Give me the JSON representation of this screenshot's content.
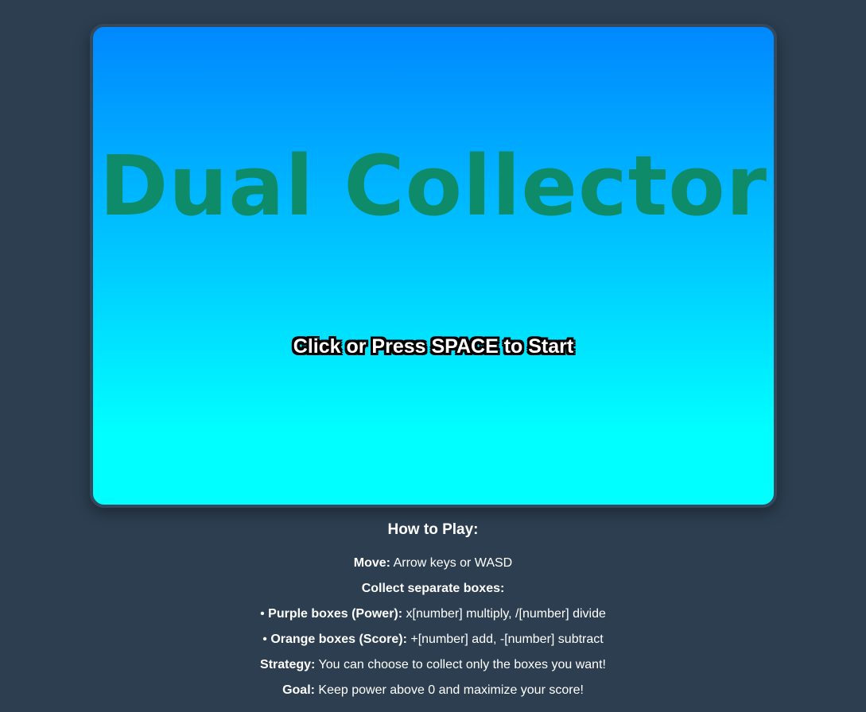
{
  "game": {
    "title": "Dual Collector",
    "start_prompt": "Click or Press SPACE to Start"
  },
  "instructions": {
    "heading": "How to Play:",
    "move_label": "Move:",
    "move_text": " Arrow keys or WASD",
    "collect_label": "Collect separate boxes:",
    "purple_bullet": "• ",
    "purple_label": "Purple boxes (Power):",
    "purple_text": " x[number] multiply, /[number] divide",
    "orange_bullet": "• ",
    "orange_label": "Orange boxes (Score):",
    "orange_text": " +[number] add, -[number] subtract",
    "strategy_label": "Strategy:",
    "strategy_text": " You can choose to collect only the boxes you want!",
    "goal_label": "Goal:",
    "goal_text": " Keep power above 0 and maximize your score!"
  },
  "colors": {
    "page_background": "#2c3e50",
    "sky_top": "#0088ff",
    "sky_bottom": "#00ffff",
    "title_color": "#0e8c6a"
  }
}
